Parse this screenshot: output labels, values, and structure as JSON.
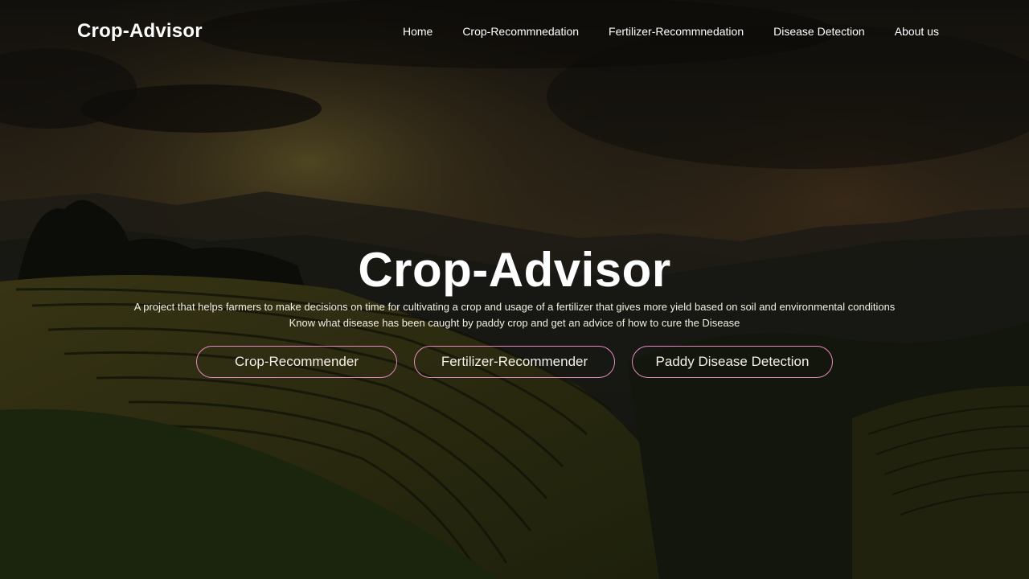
{
  "navbar": {
    "brand": "Crop-Advisor",
    "links": [
      {
        "label": "Home"
      },
      {
        "label": "Crop-Recommnedation"
      },
      {
        "label": "Fertilizer-Recommnedation"
      },
      {
        "label": "Disease Detection"
      },
      {
        "label": "About us"
      }
    ]
  },
  "hero": {
    "title": "Crop-Advisor",
    "description_line1": "A project that helps farmers to make decisions on time for cultivating a crop and usage of a fertilizer that gives more yield based on soil and environmental conditions",
    "description_line2": "Know what disease has been caught by paddy crop and get an advice of how to cure the Disease",
    "buttons": [
      {
        "label": "Crop-Recommender"
      },
      {
        "label": "Fertilizer-Recommender"
      },
      {
        "label": "Paddy Disease Detection"
      }
    ]
  },
  "colors": {
    "button_border": "#e88ac0",
    "text": "#ffffff",
    "overlay": "#000000"
  }
}
